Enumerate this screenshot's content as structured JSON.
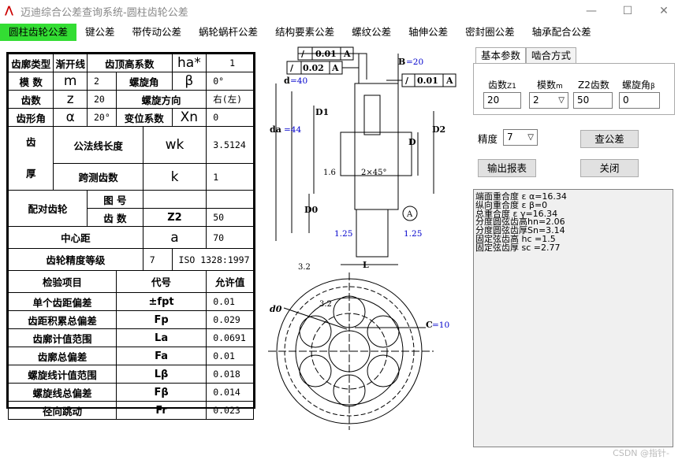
{
  "window": {
    "title": "迈迪综合公差查询系统-圆柱齿轮公差",
    "app_icon": "迈",
    "minimize": "—",
    "maximize": "☐",
    "close": "✕"
  },
  "menu": [
    {
      "label": "圆柱齿轮公差",
      "active": true
    },
    {
      "label": "键公差"
    },
    {
      "label": "带传动公差"
    },
    {
      "label": "蜗轮蜗杆公差"
    },
    {
      "label": "结构要素公差"
    },
    {
      "label": "螺纹公差"
    },
    {
      "label": "轴伸公差"
    },
    {
      "label": "密封圈公差"
    },
    {
      "label": "轴承配合公差"
    }
  ],
  "table": {
    "r1": {
      "c1": "齿廓类型",
      "c2": "渐开线",
      "c3": "齿顶高系数",
      "c4": "ha*",
      "c5": "1"
    },
    "r2": {
      "c1": "模 数",
      "c2": "m",
      "c3": "2",
      "c4": "螺旋角",
      "c5": "β",
      "c6": "0°"
    },
    "r3": {
      "c1": "齿数",
      "c2": "z",
      "c3": "20",
      "c4": "螺旋方向",
      "c5": "右(左)"
    },
    "r4": {
      "c1": "齿形角",
      "c2": "α",
      "c3": "20°",
      "c4": "变位系数",
      "c5": "Xn",
      "c6": "0"
    },
    "r5": {
      "c1a": "齿",
      "c1b": "厚",
      "c2": "公法线长度",
      "c3": "wk",
      "c4": "3.5124"
    },
    "r6": {
      "c2": "跨测齿数",
      "c3": "k",
      "c4": "1"
    },
    "r7": {
      "c1": "配对齿轮",
      "c2": "图 号",
      "c3": "",
      "c4": ""
    },
    "r8": {
      "c2": "齿 数",
      "c3": "Z2",
      "c4": "50"
    },
    "r9": {
      "c1": "中心距",
      "c2": "a",
      "c3": "70"
    },
    "r10": {
      "c1": "齿轮精度等级",
      "c2": "7",
      "c3": "ISO 1328:1997"
    },
    "head": {
      "c1": "检验项目",
      "c2": "代号",
      "c3": "允许值"
    },
    "checks": [
      {
        "name": "单个齿距偏差",
        "code": "±fpt",
        "value": "0.01"
      },
      {
        "name": "齿距积累总偏差",
        "code": "Fp",
        "value": "0.029"
      },
      {
        "name": "齿廓计值范围",
        "code": "La",
        "value": "0.0691"
      },
      {
        "name": "齿廓总偏差",
        "code": "Fa",
        "value": "0.01"
      },
      {
        "name": "螺旋线计值范围",
        "code": "Lβ",
        "value": "0.018"
      },
      {
        "name": "螺旋线总偏差",
        "code": "Fβ",
        "value": "0.014"
      },
      {
        "name": "径向跳动",
        "code": "Fr",
        "value": "0.023"
      }
    ]
  },
  "drawing": {
    "tol1_val": "0.01",
    "tol1_ref": "A",
    "tol2_val": "0.02",
    "tol2_ref": "A",
    "tol3_val": "0.01",
    "tol3_ref": "A",
    "b_label": "B",
    "b_val": "=20",
    "d_label": "d",
    "d_val": "=40",
    "da_label": "da",
    "da_val": "=44",
    "d1": "D1",
    "d2": "D2",
    "dd": "D",
    "d0": "D0",
    "rough1": "1.6",
    "chamfer": "2×45°",
    "r125a": "1.25",
    "r125b": "1.25",
    "datum": "A",
    "l_label": "L",
    "rough2": "3.2",
    "d0small": "d0",
    "rough3": "3.2",
    "c_label": "C",
    "c_val": "=10"
  },
  "tabs": [
    {
      "label": "基本参数",
      "active": true
    },
    {
      "label": "啮合方式"
    }
  ],
  "params": {
    "z1_label": "齿数",
    "z1_sub": "Z1",
    "z1_value": "20",
    "m_label": "模数",
    "m_sub": "m",
    "m_value": "2",
    "z2_label": "Z2齿数",
    "z2_value": "50",
    "beta_label": "螺旋角",
    "beta_sub": "β",
    "beta_value": "0"
  },
  "precision": {
    "label": "精度",
    "value": "7"
  },
  "buttons": {
    "query": "查公差",
    "export": "输出报表",
    "close": "关闭"
  },
  "results": [
    "端面重合度 ε α=16.34",
    "纵向重合度 ε β=0",
    "总重合度 ε γ=16.34",
    "分度圆弦齿高hn=2.06",
    "分度圆弦齿厚Sn=3.14",
    "固定弦齿高 hc =1.5",
    "固定弦齿厚 sc =2.77"
  ],
  "watermark": "CSDN @指针-"
}
